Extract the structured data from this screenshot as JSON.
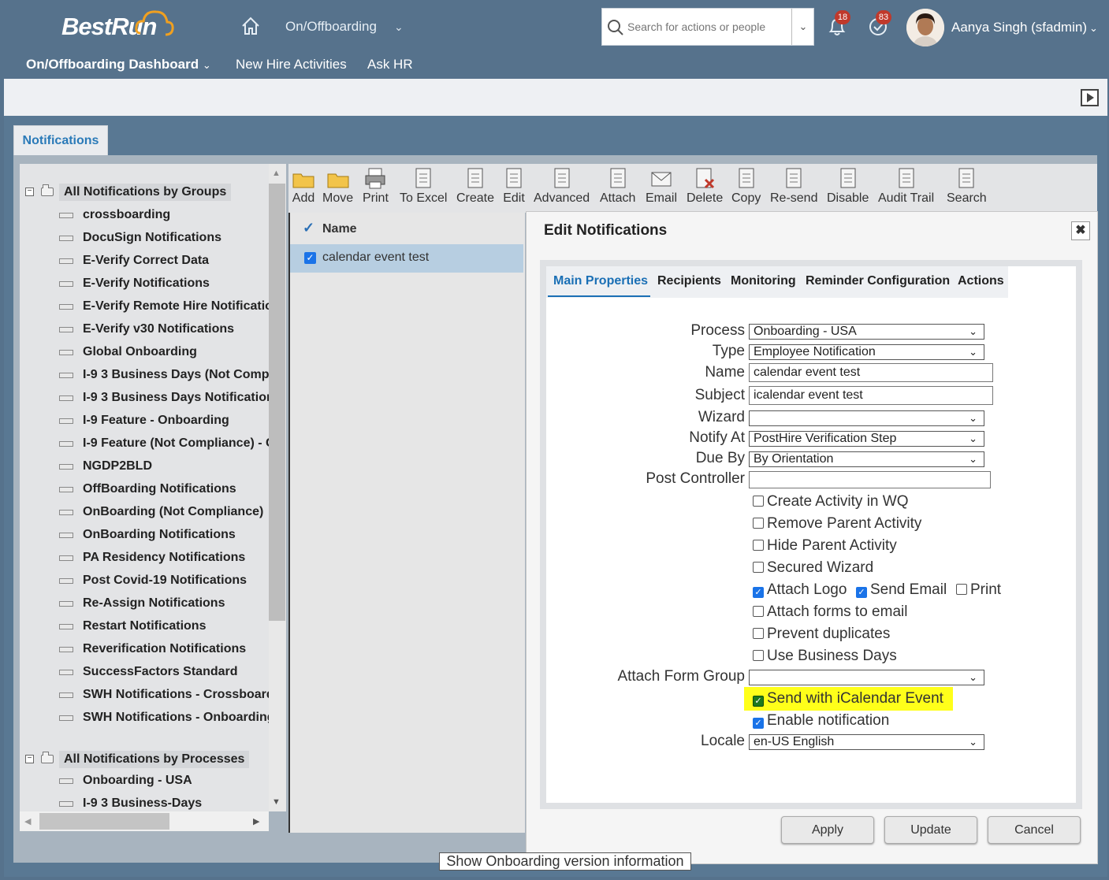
{
  "header": {
    "logo": "BestRun",
    "module": "On/Offboarding",
    "search_placeholder": "Search for actions or people",
    "notifications_count": "18",
    "tasks_count": "83",
    "user_name": "Aanya Singh (sfadmin)"
  },
  "nav": {
    "dashboard": "On/Offboarding Dashboard",
    "new_hire": "New Hire Activities",
    "ask_hr": "Ask HR"
  },
  "tab": "Notifications",
  "tree": {
    "groups_title": "All Notifications by Groups",
    "groups": [
      "crossboarding",
      "DocuSign Notifications",
      "E-Verify Correct Data",
      "E-Verify Notifications",
      "E-Verify Remote Hire Notificatio",
      "E-Verify v30 Notifications",
      "Global Onboarding",
      "I-9 3 Business Days (Not Compl",
      "I-9 3 Business Days Notificatior",
      "I-9 Feature - Onboarding",
      "I-9 Feature (Not Compliance) - C",
      "NGDP2BLD",
      "OffBoarding Notifications",
      "OnBoarding (Not Compliance)",
      "OnBoarding Notifications",
      "PA Residency Notifications",
      "Post Covid-19 Notifications",
      "Re-Assign Notifications",
      "Restart Notifications",
      "Reverification Notifications",
      "SuccessFactors Standard",
      "SWH Notifications - Crossboard",
      "SWH Notifications - Onboarding"
    ],
    "processes_title": "All Notifications by Processes",
    "processes": [
      "Onboarding - USA",
      "I-9 3 Business-Days"
    ]
  },
  "toolbar": [
    "Add",
    "Move",
    "Print",
    "To Excel",
    "Create",
    "Edit",
    "Advanced",
    "Attach",
    "Email",
    "Delete",
    "Copy",
    "Re-send",
    "Disable",
    "Audit Trail",
    "Search"
  ],
  "grid": {
    "column": "Name",
    "row": "calendar event test"
  },
  "dialog": {
    "title": "Edit Notifications",
    "tabs": [
      "Main Properties",
      "Recipients",
      "Monitoring",
      "Reminder Configuration",
      "Actions"
    ],
    "labels": {
      "process": "Process",
      "type": "Type",
      "name": "Name",
      "subject": "Subject",
      "wizard": "Wizard",
      "notify_at": "Notify At",
      "due_by": "Due By",
      "post_controller": "Post Controller",
      "attach_form_group": "Attach Form Group",
      "locale": "Locale"
    },
    "values": {
      "process": "Onboarding - USA",
      "type": "Employee Notification",
      "name": "calendar event test",
      "subject": "icalendar event test",
      "wizard": "",
      "notify_at": "PostHire Verification Step",
      "due_by": "By Orientation",
      "post_controller": "",
      "attach_form_group": "",
      "locale": "en-US English"
    },
    "checkboxes": {
      "create_activity": "Create Activity in WQ",
      "remove_parent": "Remove Parent Activity",
      "hide_parent": "Hide Parent Activity",
      "secured_wizard": "Secured Wizard",
      "attach_logo": "Attach Logo",
      "send_email": "Send Email",
      "print": "Print",
      "attach_forms": "Attach forms to email",
      "prevent_duplicates": "Prevent duplicates",
      "business_days": "Use Business Days",
      "icalendar": "Send with iCalendar Event",
      "enable": "Enable notification"
    },
    "buttons": {
      "apply": "Apply",
      "update": "Update",
      "cancel": "Cancel"
    }
  },
  "footer": "Show Onboarding version information",
  "colors": {
    "shell": "#56728c",
    "highlight": "#ffff1a",
    "accent": "#1a6fb5"
  }
}
